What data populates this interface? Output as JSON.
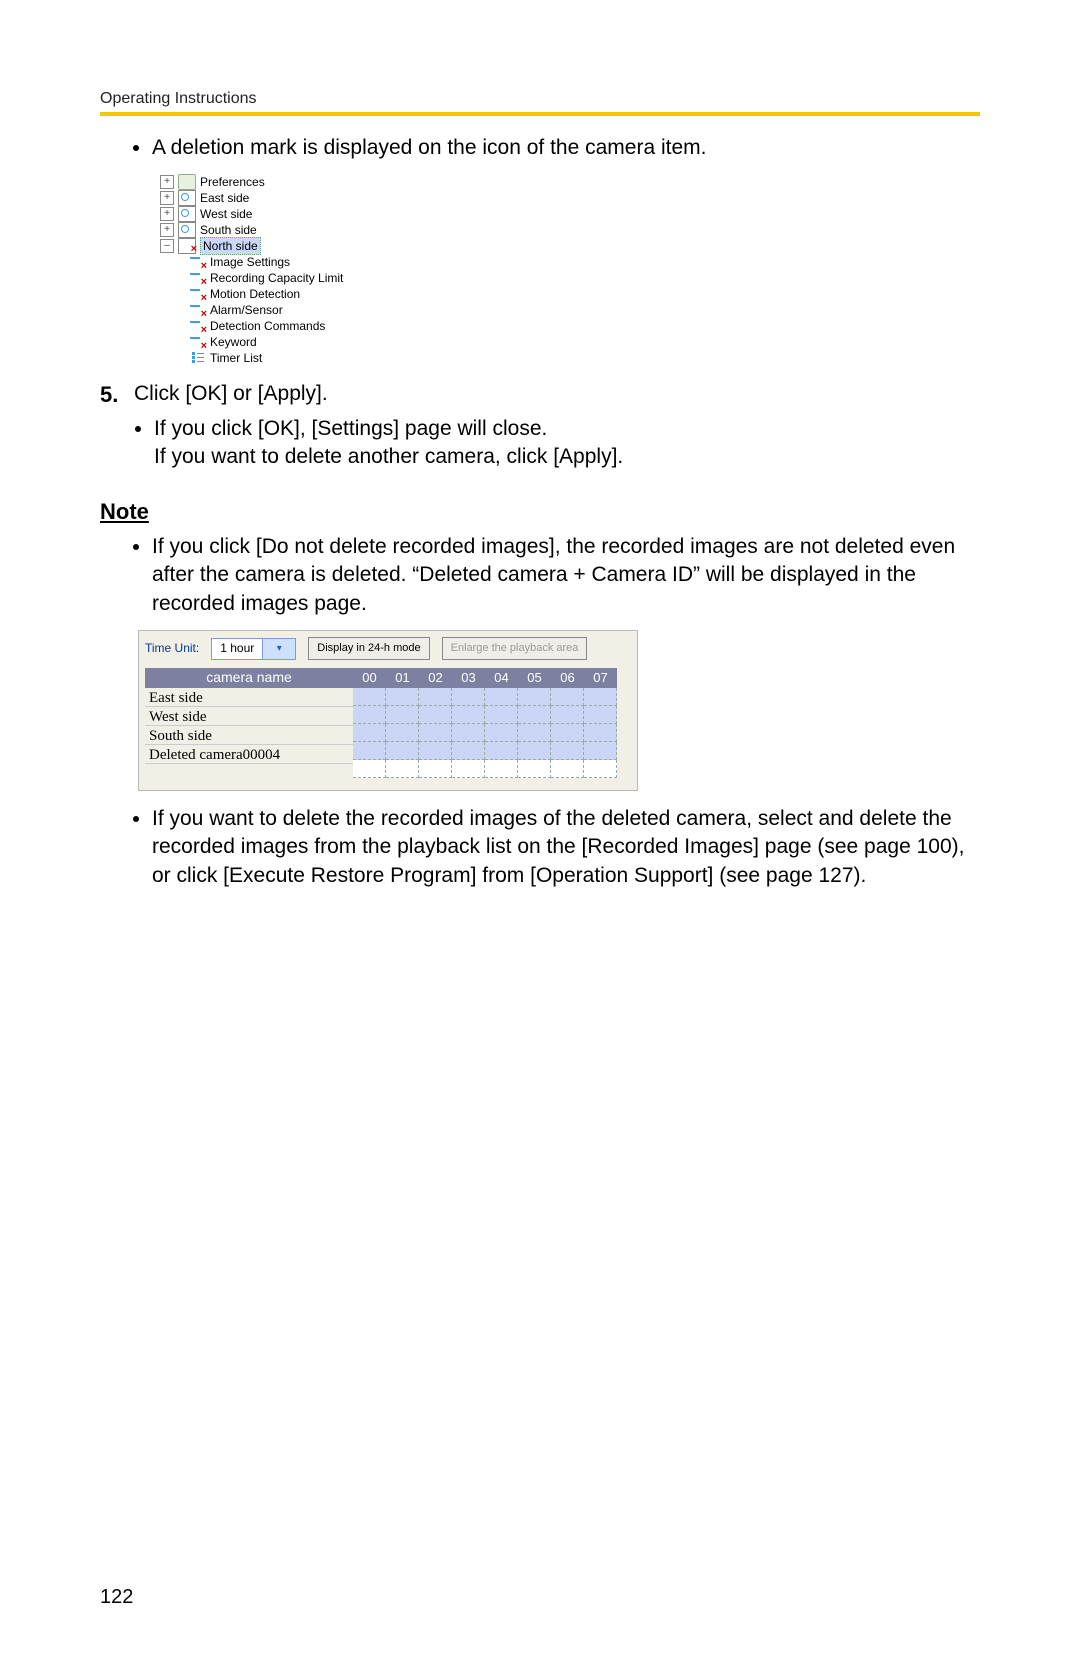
{
  "header": "Operating Instructions",
  "bullet1": "A deletion mark is displayed on the icon of the camera item.",
  "tree": {
    "preferences": "Preferences",
    "east": "East side",
    "west": "West side",
    "south": "South side",
    "north": "North side",
    "children": {
      "image_settings": "Image Settings",
      "rec_cap": "Recording Capacity Limit",
      "motion": "Motion Detection",
      "alarm": "Alarm/Sensor",
      "detect_cmd": "Detection Commands",
      "keyword": "Keyword",
      "timer": "Timer List"
    }
  },
  "step5": {
    "num": "5.",
    "text": "Click [OK] or [Apply].",
    "sub1": "If you click [OK], [Settings] page will close.",
    "sub2": "If you want to delete another camera, click [Apply]."
  },
  "note_heading": "Note",
  "note_bullet1": "If you click [Do not delete recorded images], the recorded images are not deleted even after the camera is deleted. “Deleted camera + Camera ID” will be displayed in the recorded images page.",
  "playback": {
    "time_unit_label": "Time Unit:",
    "time_unit_value": "1 hour",
    "btn_24h": "Display in 24-h mode",
    "btn_enlarge": "Enlarge the playback area",
    "col_header": "camera name",
    "hours": [
      "00",
      "01",
      "02",
      "03",
      "04",
      "05",
      "06",
      "07"
    ],
    "rows": [
      "East side",
      "West side",
      "South side",
      "Deleted camera00004"
    ]
  },
  "note_bullet2": "If you want to delete the recorded images of the deleted camera, select and delete the recorded images from the playback list on the [Recorded Images] page (see page 100), or click [Execute Restore Program] from [Operation Support] (see page 127).",
  "page_number": "122"
}
